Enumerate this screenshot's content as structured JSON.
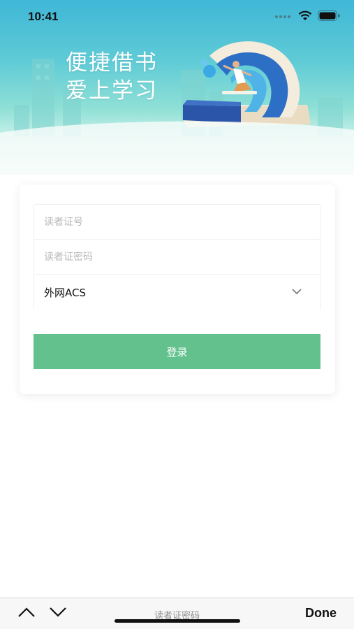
{
  "status_bar": {
    "time": "10:41"
  },
  "banner": {
    "slogan_line1": "便捷借书",
    "slogan_line2": "爱上学习"
  },
  "login_form": {
    "card_number_placeholder": "读者证号",
    "password_placeholder": "读者证密码",
    "network_select_value": "外网ACS",
    "login_label": "登录"
  },
  "keyboard_accessory": {
    "field_label": "读者证密码",
    "done_label": "Done"
  },
  "colors": {
    "primary_green": "#62c18d",
    "banner_top": "#3fb7d7",
    "banner_mid": "#8fe0d6"
  }
}
